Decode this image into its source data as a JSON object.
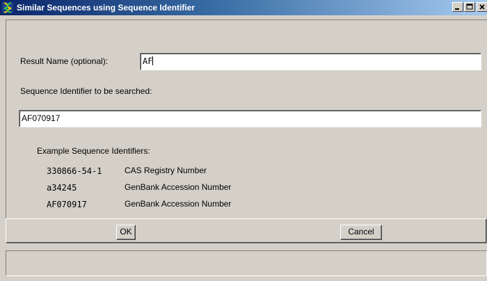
{
  "window": {
    "title": "Similar Sequences using Sequence Identifier",
    "icon": "helix-app-icon",
    "controls": [
      "minimize-icon",
      "maximize-icon",
      "close-icon"
    ]
  },
  "form": {
    "result_name_label": "Result Name (optional):",
    "result_name_value": "AF",
    "sequence_id_label": "Sequence Identifier to be searched:",
    "sequence_id_value": "AF070917"
  },
  "examples": {
    "heading": "Example Sequence Identifiers:",
    "items": [
      {
        "id": "330866-54-1",
        "description": "CAS Registry Number"
      },
      {
        "id": "a34245",
        "description": "GenBank Accession Number"
      },
      {
        "id": "AF070917",
        "description": "GenBank Accession Number"
      }
    ]
  },
  "buttons": {
    "ok_label": "OK",
    "cancel_label": "Cancel"
  },
  "status": {
    "text": ""
  },
  "colors": {
    "title_gradient_start": "#0a246a",
    "title_gradient_end": "#a6caf0",
    "background": "#d4d0c8"
  }
}
